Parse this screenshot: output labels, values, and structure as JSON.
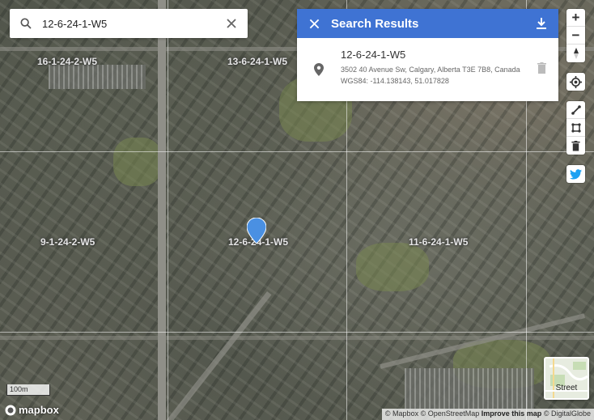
{
  "search": {
    "value": "12-6-24-1-W5",
    "icon": "search-icon",
    "clear_icon": "close-icon"
  },
  "results_panel": {
    "title": "Search Results",
    "close_icon": "close-icon",
    "download_icon": "download-icon",
    "items": [
      {
        "name": "12-6-24-1-W5",
        "address": "3502 40 Avenue Sw, Calgary, Alberta T3E 7B8, Canada",
        "coordinates": "WGS84: -114.138143, 51.017828",
        "icon": "location-pin-icon",
        "delete_icon": "trash-icon"
      }
    ]
  },
  "grid_labels": [
    {
      "label": "16-1-24-2-W5"
    },
    {
      "label": "13-6-24-1-W5"
    },
    {
      "label": "9-1-24-2-W5"
    },
    {
      "label": "12-6-24-1-W5"
    },
    {
      "label": "11-6-24-1-W5"
    }
  ],
  "map_controls": {
    "zoom_in": "+",
    "zoom_out": "−",
    "compass_icon": "compass-icon",
    "geolocate_icon": "crosshair-icon",
    "draw_line_icon": "line-draw-icon",
    "draw_polygon_icon": "polygon-draw-icon",
    "trash_icon": "trash-icon",
    "twitter_icon": "twitter-icon"
  },
  "scale_label": "100m",
  "logo_text": "mapbox",
  "style_switcher": {
    "label": "Street"
  },
  "attribution": {
    "mapbox": "© Mapbox",
    "osm": "© OpenStreetMap",
    "improve": "Improve this map",
    "digitalglobe": "© DigitalGlobe"
  },
  "colors": {
    "header_blue": "#3f73d3",
    "marker_blue": "#4a90e2"
  }
}
